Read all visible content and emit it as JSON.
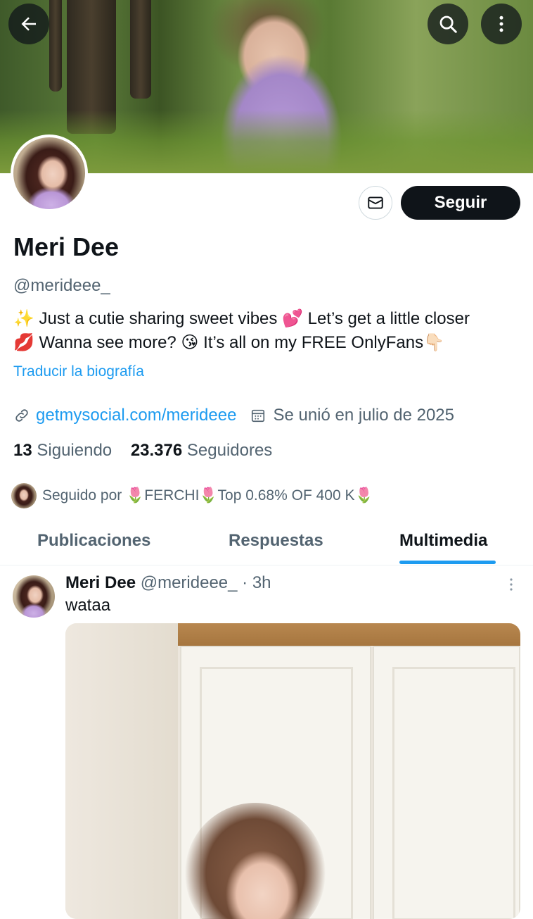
{
  "header": {
    "back_icon": "arrow-left-icon",
    "search_icon": "search-icon",
    "more_icon": "more-vertical-icon"
  },
  "profile": {
    "name": "Meri Dee",
    "handle": "@merideee_",
    "bio_line1": "✨ Just a cutie sharing sweet vibes 💕 Let’s get a little closer",
    "bio_line2": "💋  Wanna see more? 😘 It’s all on my FREE OnlyFans👇🏻",
    "translate_label": "Traducir la biografía",
    "link": "getmysocial.com/merideee",
    "joined": "Se unió en julio de 2025",
    "following_count": "13",
    "following_label": "Siguiendo",
    "followers_count": "23.376",
    "followers_label": "Seguidores",
    "followed_by": "Seguido por 🌷FERCHI🌷Top 0.68% OF 400 K🌷",
    "follow_label": "Seguir"
  },
  "tabs": [
    {
      "label": "Publicaciones"
    },
    {
      "label": "Respuestas"
    },
    {
      "label": "Multimedia"
    }
  ],
  "post": {
    "author": "Meri Dee",
    "handle": "@merideee_",
    "time": "· 3h",
    "text": "wataa"
  },
  "colors": {
    "accent": "#1d9bf0",
    "text": "#0f1419",
    "muted": "#536471"
  }
}
